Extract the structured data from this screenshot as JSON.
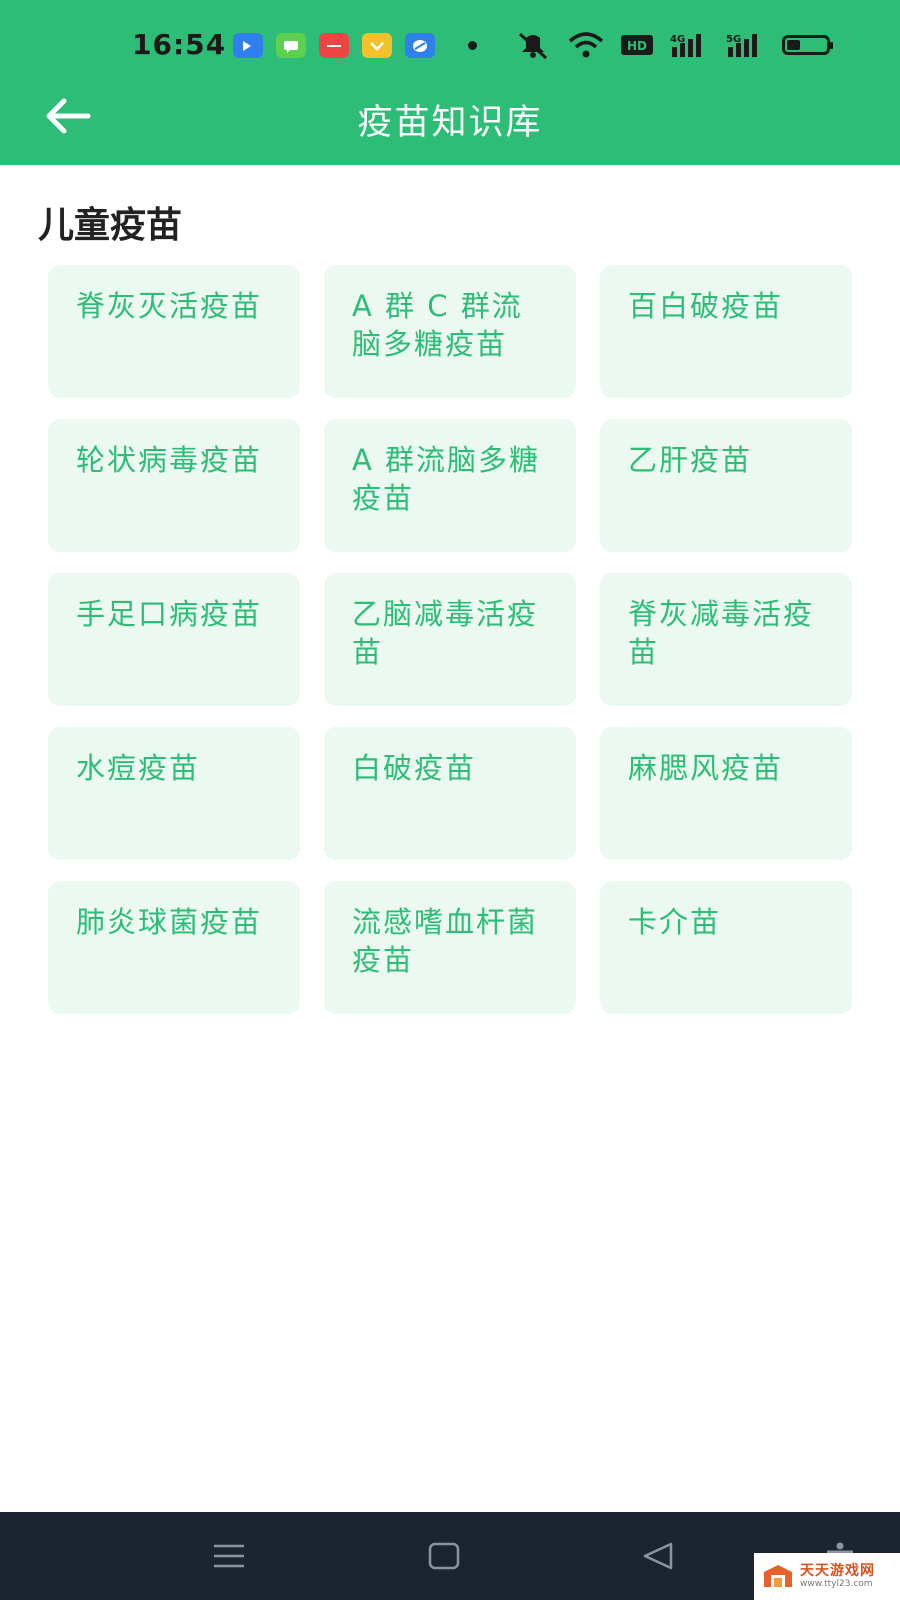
{
  "status_bar": {
    "time": "16:54",
    "hd_badge": "HD",
    "signal_1": "4G",
    "signal_2": "5G",
    "battery_level": 0.35,
    "app_icons": [
      {
        "name": "app-icon-blue",
        "color": "#2f80ed"
      },
      {
        "name": "app-icon-green-chat",
        "color": "#5ed04f"
      },
      {
        "name": "app-icon-red-store",
        "color": "#ef4444"
      },
      {
        "name": "app-icon-yellow",
        "color": "#f3c22b"
      },
      {
        "name": "app-icon-browser",
        "color": "#2f80ed"
      }
    ]
  },
  "app_bar": {
    "title": "疫苗知识库",
    "back_icon": "arrow-left-icon"
  },
  "section": {
    "title": "儿童疫苗"
  },
  "vaccines": [
    {
      "label": "脊灰灭活疫苗"
    },
    {
      "label": "A 群 C 群流脑多糖疫苗"
    },
    {
      "label": "百白破疫苗"
    },
    {
      "label": "轮状病毒疫苗"
    },
    {
      "label": "A 群流脑多糖疫苗"
    },
    {
      "label": "乙肝疫苗"
    },
    {
      "label": "手足口病疫苗"
    },
    {
      "label": "乙脑减毒活疫苗"
    },
    {
      "label": "脊灰减毒活疫苗"
    },
    {
      "label": "水痘疫苗"
    },
    {
      "label": "白破疫苗"
    },
    {
      "label": "麻腮风疫苗"
    },
    {
      "label": "肺炎球菌疫苗"
    },
    {
      "label": "流感嗜血杆菌疫苗"
    },
    {
      "label": "卡介苗"
    }
  ],
  "nav_bar": {
    "icons": [
      "menu-icon",
      "home-icon",
      "back-triangle-icon",
      "accessibility-icon"
    ]
  },
  "watermark": {
    "title": "天天游戏网",
    "url": "www.ttyl23.com"
  },
  "colors": {
    "primary": "#2dbd76",
    "card_bg": "#ebf9f1",
    "nav_bg": "#1c2430"
  }
}
